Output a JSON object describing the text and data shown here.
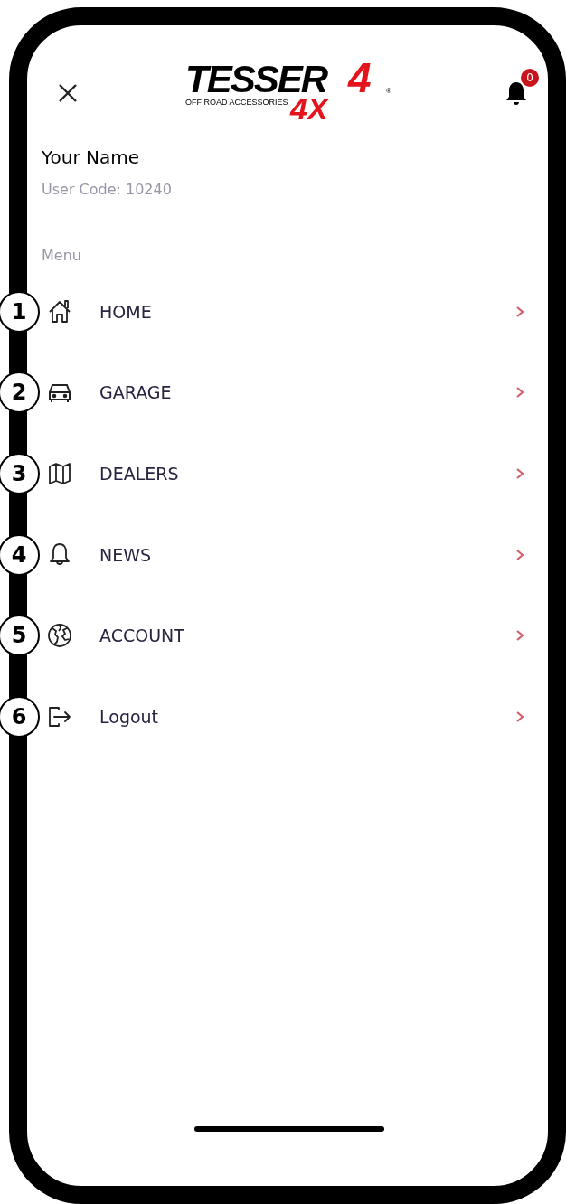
{
  "header": {
    "logo": {
      "wordmark": "TESSER",
      "numeral": "4",
      "suffix": "4X",
      "tagline": "OFF ROAD ACCESSORIES",
      "registered": "®"
    },
    "notification_count": "0"
  },
  "profile": {
    "name": "Your Name",
    "user_code": "User Code: 10240"
  },
  "menu": {
    "title": "Menu",
    "items": [
      {
        "label": "HOME",
        "callout": "1"
      },
      {
        "label": "GARAGE",
        "callout": "2"
      },
      {
        "label": "DEALERS",
        "callout": "3"
      },
      {
        "label": "NEWS",
        "callout": "4"
      },
      {
        "label": "ACCOUNT",
        "callout": "5"
      },
      {
        "label": "Logout",
        "callout": "6"
      }
    ]
  }
}
